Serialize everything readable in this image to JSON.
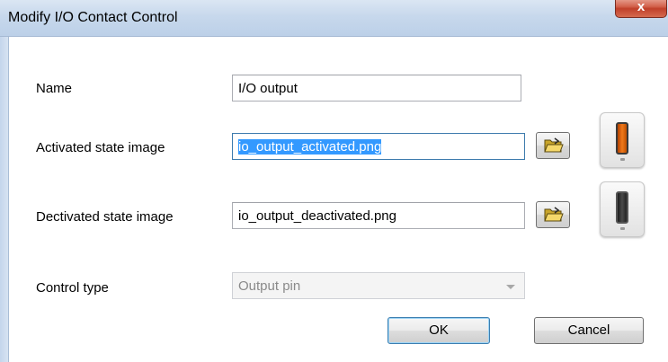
{
  "window": {
    "title": "Modify I/O Contact Control",
    "close_glyph": "x"
  },
  "form": {
    "name": {
      "label": "Name",
      "value": "I/O output"
    },
    "activated": {
      "label": "Activated state image",
      "value": "io_output_activated.png",
      "browse_icon": "open-folder-icon",
      "preview": "orange switch (on)"
    },
    "deactivated": {
      "label": "Dectivated state image",
      "value": "io_output_deactivated.png",
      "browse_icon": "open-folder-icon",
      "preview": "black switch (off)"
    },
    "control_type": {
      "label": "Control type",
      "value": "Output pin",
      "enabled": false
    }
  },
  "buttons": {
    "ok": "OK",
    "cancel": "Cancel"
  },
  "colors": {
    "selection": "#3399ff",
    "titlebar": "#c7d8ec",
    "close": "#c0402a",
    "switch_on": "#f07a1c",
    "switch_off": "#2a2a2a"
  }
}
